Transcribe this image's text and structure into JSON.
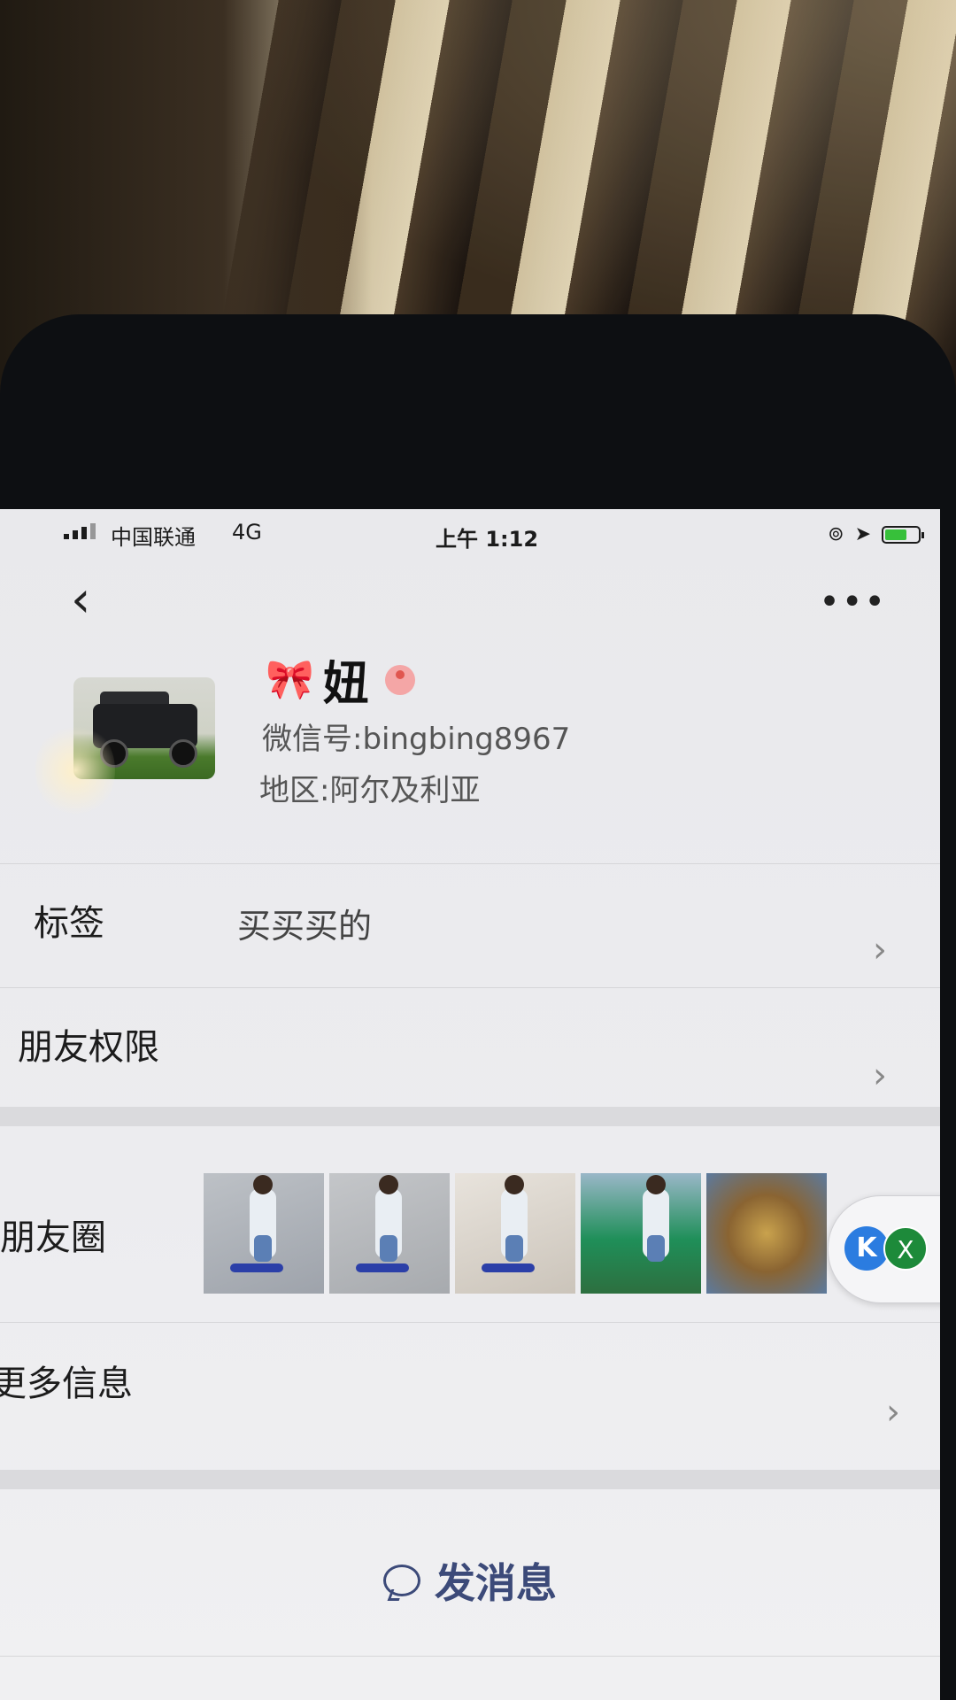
{
  "status_bar": {
    "carrier": "中国联通",
    "network": "4G",
    "time": "上午 1:12"
  },
  "nav": {
    "back_icon": "back-chevron-icon",
    "more_icon": "more-dots-icon"
  },
  "profile": {
    "nickname": "妞",
    "wechat_id_label": "微信号:",
    "wechat_id": "bingbing8967",
    "region_label": "地区:",
    "region": "阿尔及利亚",
    "gender": "female"
  },
  "rows": {
    "tags_label": "标签",
    "tags_value": "买买买的",
    "permissions_label": "朋友权限",
    "moments_label": "朋友圈",
    "more_info_label": "更多信息"
  },
  "actions": {
    "send_message": "发消息"
  },
  "floating_widget": {
    "k_label": "K",
    "x_label": "X"
  },
  "colors": {
    "accent": "#3c4a79",
    "screen_bg": "#ececef",
    "divider": "#d6d6d9"
  }
}
